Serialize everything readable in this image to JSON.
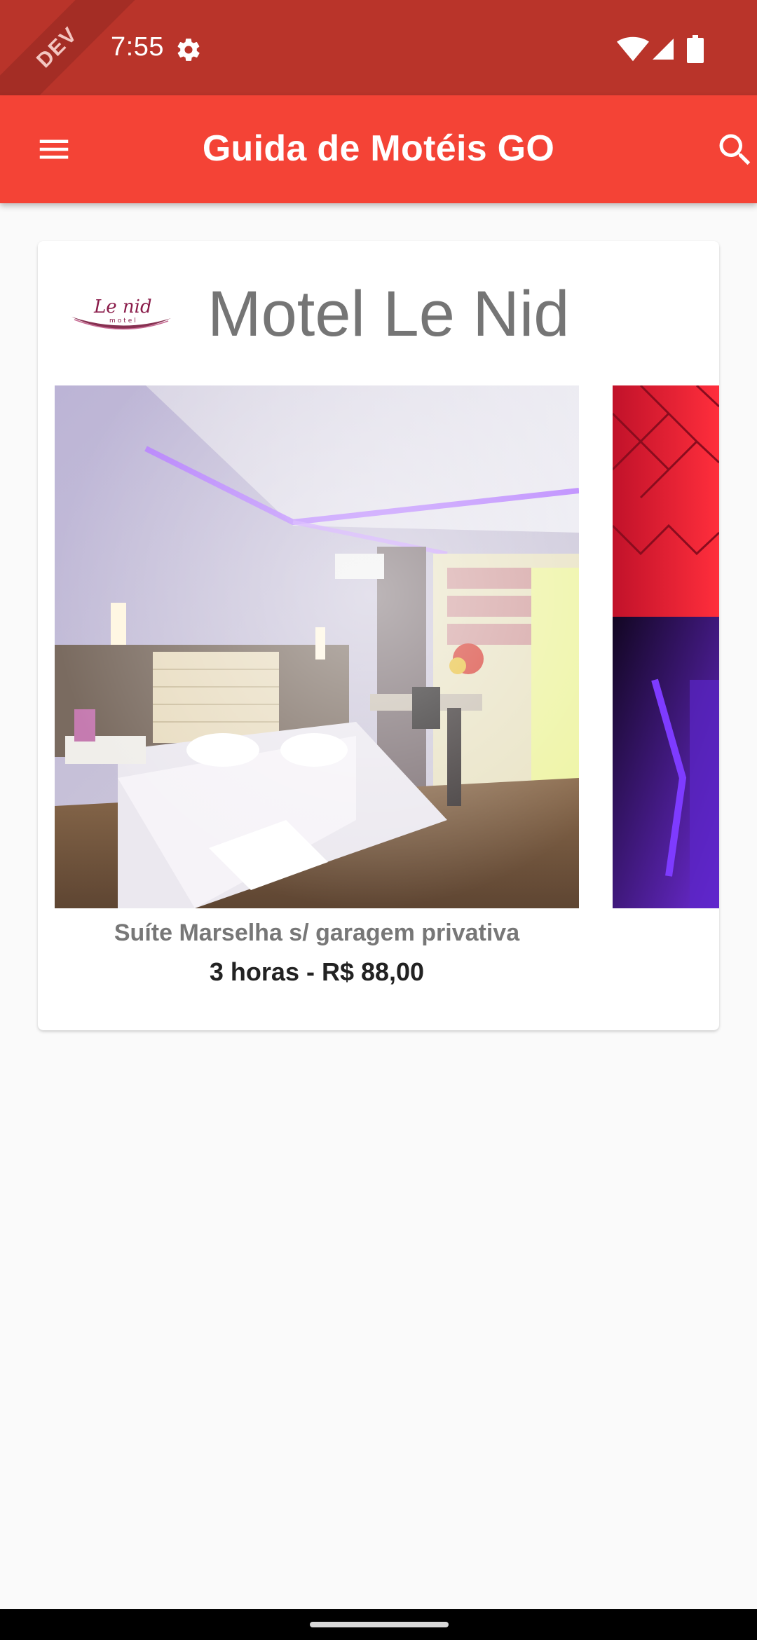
{
  "status": {
    "time": "7:55",
    "dev_label": "DEV"
  },
  "appbar": {
    "title": "Guida de Motéis GO"
  },
  "motel": {
    "name": "Motel Le Nid",
    "logo_text": "Le nid",
    "logo_sub": "motel"
  },
  "carousel": {
    "items": [
      {
        "title": "Suíte Marselha s/ garagem privativa",
        "price": "3 horas - R$ 88,00"
      }
    ]
  },
  "colors": {
    "status_bar": "#b9342a",
    "app_bar": "#f44336",
    "background": "#fafafa"
  },
  "icons": [
    "menu-icon",
    "search-icon",
    "gear-icon",
    "wifi-icon",
    "signal-icon",
    "battery-icon"
  ]
}
